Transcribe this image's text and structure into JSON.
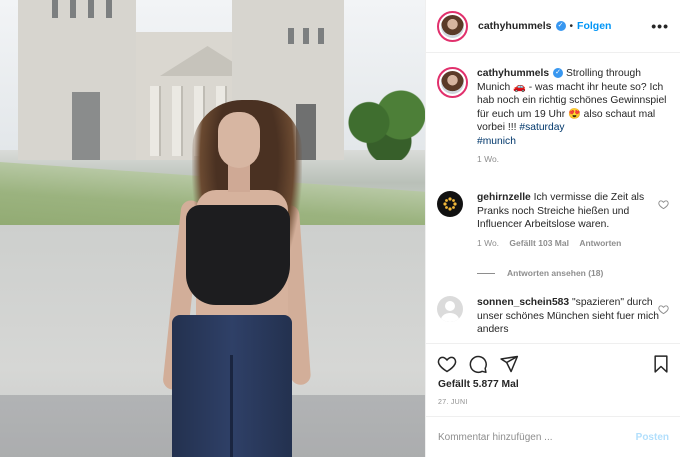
{
  "post": {
    "image_alt": "Woman with long brown hair in black top and jeans in front of Propylaea, Munich"
  },
  "header": {
    "username": "cathyhummels",
    "separator": "•",
    "follow_label": "Folgen",
    "more_label": "•••"
  },
  "caption": {
    "username": "cathyhummels",
    "text": "Strolling through Munich 🚗 - was macht ihr heute so? Ich hab noch ein richtig schönes Gewinnspiel für euch um 19 Uhr 😍 also schaut mal vorbei !!! ",
    "tags": [
      "#saturday",
      "#munich"
    ],
    "age": "1 Wo."
  },
  "comments": [
    {
      "username": "gehirnzelle",
      "text": "Ich vermisse die Zeit als Pranks noch Streiche hießen und Influencer Arbeitslose waren.",
      "age": "1 Wo.",
      "likes": "Gefällt 103 Mal",
      "reply": "Antworten",
      "view_replies": "Antworten ansehen (18)"
    },
    {
      "username": "sonnen_schein583",
      "text": "\"spazieren\" durch unser schönes München sieht fuer mich anders"
    }
  ],
  "actions": {
    "likes": "Gefällt 5.877 Mal",
    "date": "27. JUNI"
  },
  "comment_box": {
    "placeholder": "Kommentar hinzufügen ...",
    "post_label": "Posten"
  },
  "colors": {
    "accent": "#0095f6",
    "verified": "#3897f0",
    "post_disabled": "#b2dffc",
    "muted": "#8e8e8e"
  }
}
